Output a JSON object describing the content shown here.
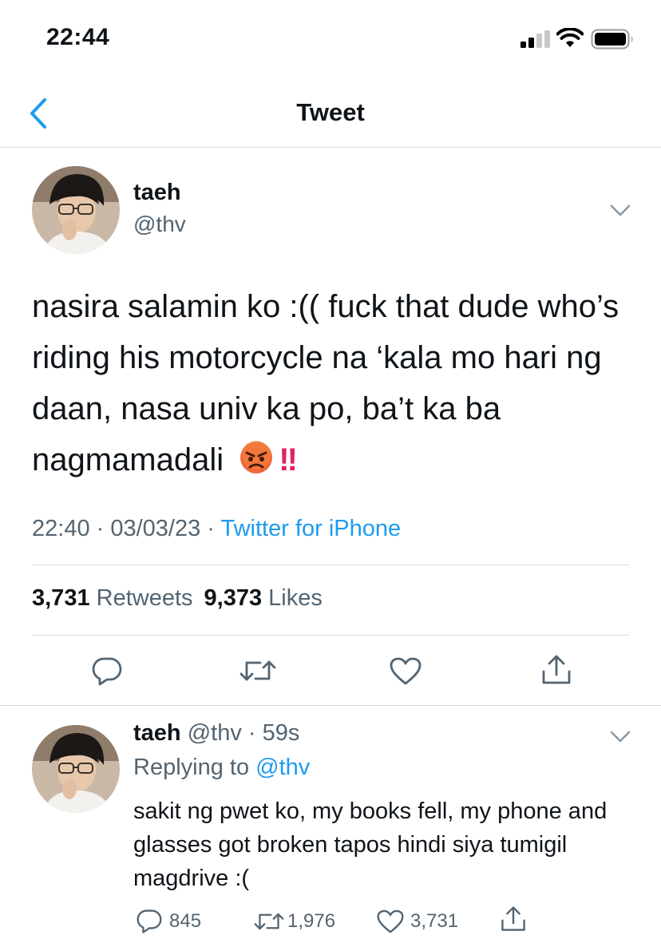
{
  "status_bar": {
    "time": "22:44"
  },
  "nav": {
    "title": "Tweet"
  },
  "tweet": {
    "name": "taeh",
    "handle": "@thv",
    "text": "nasira salamin ko :(( fuck that dude who’s riding his motorcycle na ‘kala mo hari ng daan, nasa univ ka po, ba’t ka ba nagmamadali",
    "emojis": "😡‼️",
    "time": "22:40 · 03/03/23 · ",
    "source": "Twitter for iPhone",
    "retweet_count": "3,731",
    "retweet_label": "Retweets",
    "like_count": "9,373",
    "like_label": "Likes"
  },
  "reply": {
    "name": "taeh",
    "handle_time": "@thv · 59s",
    "replying_prefix": "Replying to ",
    "replying_to": "@thv",
    "text": "sakit ng pwet ko, my books fell, my phone and glasses got broken tapos hindi siya tumigil magdrive :(",
    "reply_count": "845",
    "retweet_count": "1,976",
    "like_count": "3,731"
  },
  "icons": [
    "signal-icon",
    "wifi-icon",
    "battery-icon",
    "back-chevron-icon",
    "chevron-down-icon",
    "reply-icon",
    "retweet-icon",
    "like-icon",
    "share-icon",
    "angry-face-emoji",
    "double-exclamation-emoji"
  ],
  "colors": {
    "link_blue": "#1d9bf0",
    "secondary_text": "#536471",
    "divider": "#d6dadd"
  }
}
